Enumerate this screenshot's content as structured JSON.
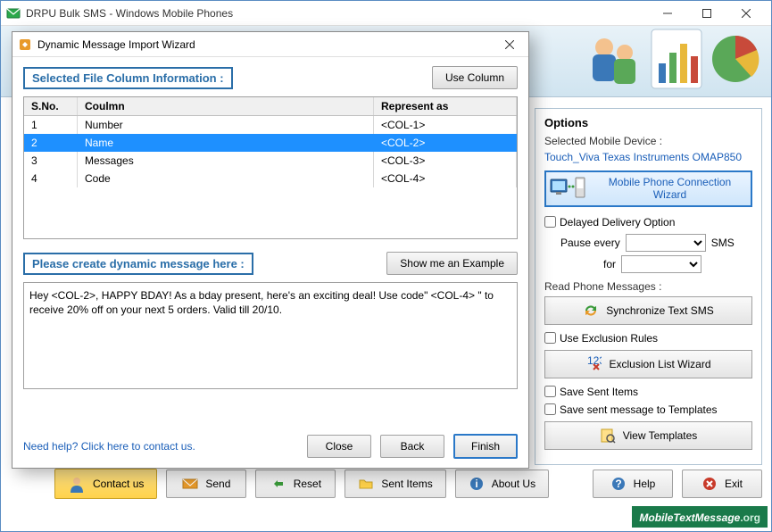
{
  "main": {
    "title": "DRPU Bulk SMS - Windows Mobile Phones"
  },
  "modal": {
    "title": "Dynamic Message Import Wizard",
    "section1_label": "Selected File Column Information :",
    "use_column_btn": "Use Column",
    "grid": {
      "headers": {
        "sno": "S.No.",
        "col": "Coulmn",
        "rep": "Represent as"
      },
      "rows": [
        {
          "sno": "1",
          "col": "Number",
          "rep": "<COL-1>",
          "selected": false
        },
        {
          "sno": "2",
          "col": "Name",
          "rep": "<COL-2>",
          "selected": true
        },
        {
          "sno": "3",
          "col": "Messages",
          "rep": "<COL-3>",
          "selected": false
        },
        {
          "sno": "4",
          "col": "Code",
          "rep": "<COL-4>",
          "selected": false
        }
      ]
    },
    "section2_label": "Please create dynamic message here :",
    "example_btn": "Show me an Example",
    "message_text": "Hey <COL-2>, HAPPY BDAY! As a bday present, here's an exciting deal! Use code\" <COL-4> \" to receive 20% off on your next 5 orders. Valid till 20/10.",
    "help_link": "Need help? Click here to contact us.",
    "close_btn": "Close",
    "back_btn": "Back",
    "finish_btn": "Finish"
  },
  "options": {
    "title": "Options",
    "selected_device_label": "Selected Mobile Device :",
    "device_name": "Touch_Viva Texas Instruments OMAP850",
    "wizard_btn": "Mobile Phone Connection  Wizard",
    "delayed_label": "Delayed Delivery Option",
    "pause_label": "Pause every",
    "sms_suffix": "SMS",
    "for_label": "for",
    "read_label": "Read Phone Messages :",
    "sync_btn": "Synchronize Text SMS",
    "exclusion_label": "Use Exclusion Rules",
    "exclusion_btn": "Exclusion List Wizard",
    "save_sent_label": "Save Sent Items",
    "save_tpl_label": "Save sent message to Templates",
    "view_tpl_btn": "View Templates"
  },
  "toolbar": {
    "contact": "Contact us",
    "send": "Send",
    "reset": "Reset",
    "sent_items": "Sent Items",
    "about": "About Us",
    "help": "Help",
    "exit": "Exit"
  },
  "watermark": {
    "text": "MobileTextMessage",
    "suffix": ".org"
  }
}
